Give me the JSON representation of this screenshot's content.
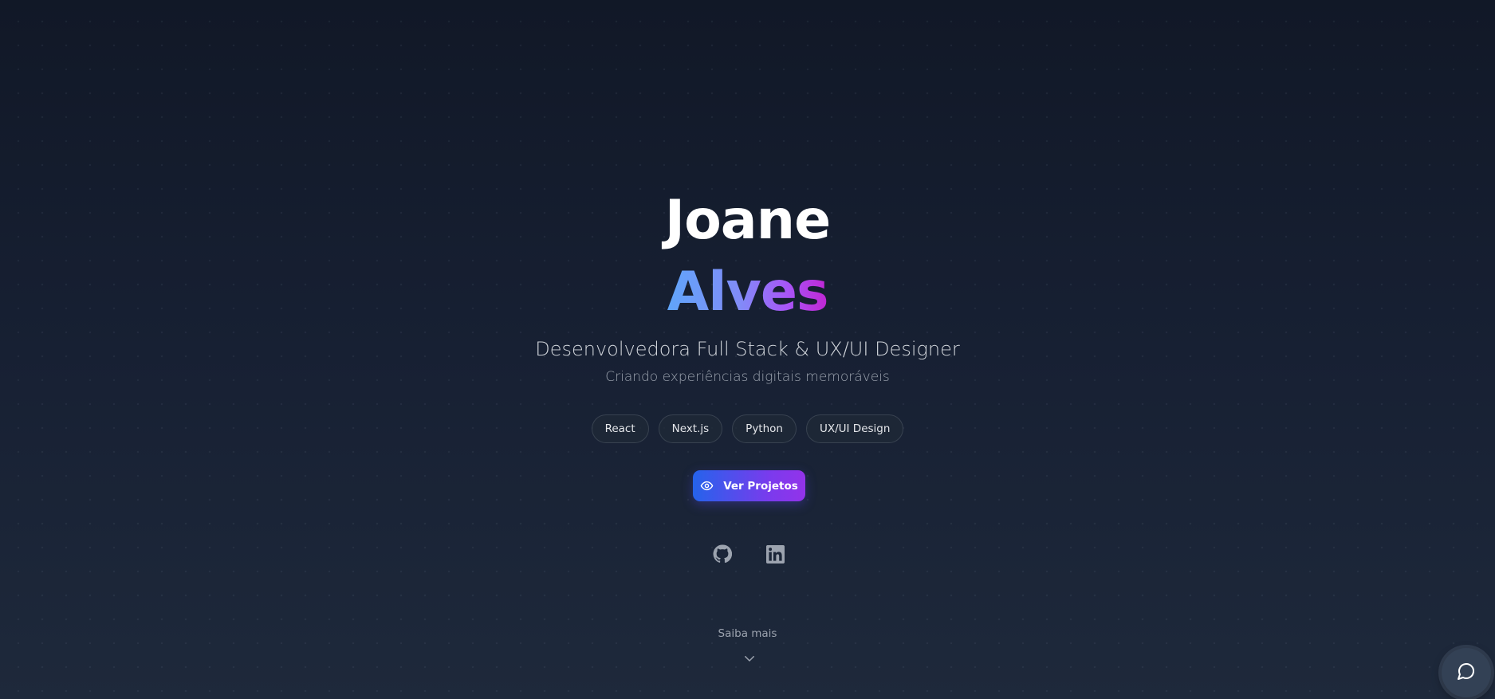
{
  "hero": {
    "first_name": "Joane",
    "last_name": "Alves",
    "role": "Desenvolvedora Full Stack & UX/UI Designer",
    "tagline": "Criando experiências digitais memoráveis"
  },
  "skills": [
    "React",
    "Next.js",
    "Python",
    "UX/UI Design"
  ],
  "cta": {
    "label": "Ver Projetos",
    "icon": "eye-icon"
  },
  "socials": [
    {
      "icon": "github-icon"
    },
    {
      "icon": "linkedin-icon"
    }
  ],
  "scroll_hint": {
    "label": "Saiba mais",
    "icon": "chevron-down-icon"
  },
  "chat_widget": {
    "icon": "chat-bubble-icon"
  },
  "colors": {
    "background_top": "#111827",
    "background_bottom": "#1e293b",
    "gradient_start": "#2563eb",
    "gradient_end": "#9333ea",
    "name_gradient_start": "#60a5fa",
    "name_gradient_end": "#c026d3"
  }
}
